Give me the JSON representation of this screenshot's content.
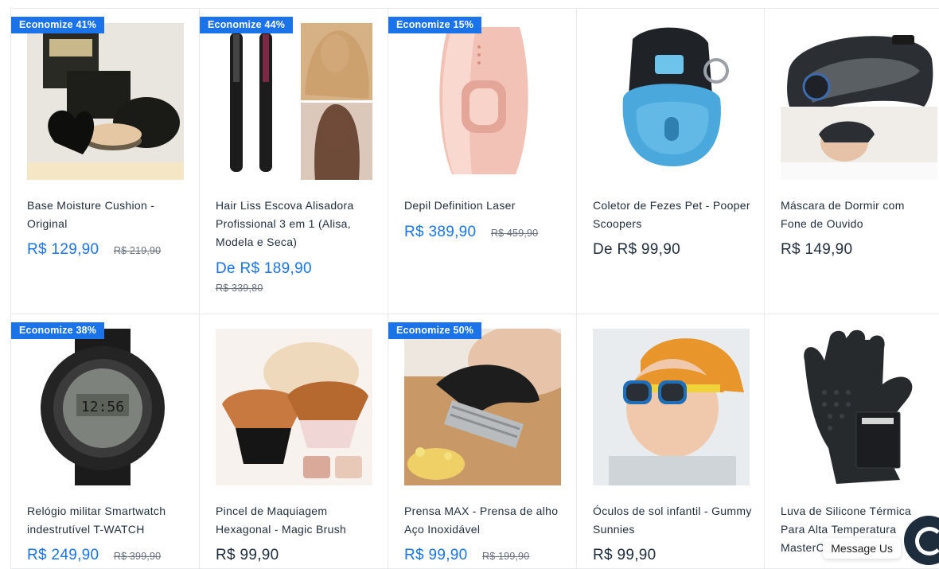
{
  "products": [
    {
      "badge": "Economize 41%",
      "title": "Base Moisture Cushion - Original",
      "price": "R$ 129,90",
      "compare": "R$ 219,90"
    },
    {
      "badge": "Economize 44%",
      "title": "Hair Liss Escova Alisadora Profissional 3 em 1 (Alisa, Modela e Seca)",
      "price": "De R$ 189,90",
      "compare": "R$ 339,80"
    },
    {
      "badge": "Economize 15%",
      "title": "Depil Definition Laser",
      "price": "R$ 389,90",
      "compare": "R$ 459,90"
    },
    {
      "badge": "",
      "title": "Coletor de Fezes Pet - Pooper Scoopers",
      "price": "De R$ 99,90",
      "compare": ""
    },
    {
      "badge": "",
      "title": "Máscara de Dormir com Fone de Ouvido",
      "price": "R$ 149,90",
      "compare": ""
    },
    {
      "badge": "Economize 38%",
      "title": "Relógio militar Smartwatch indestrutível T-WATCH",
      "price": "R$ 249,90",
      "compare": "R$ 399,90"
    },
    {
      "badge": "",
      "title": "Pincel de Maquiagem Hexagonal - Magic Brush",
      "price": "R$ 99,90",
      "compare": ""
    },
    {
      "badge": "Economize 50%",
      "title": "Prensa MAX - Prensa de alho Aço Inoxidável",
      "price": "R$ 99,90",
      "compare": "R$ 199,90"
    },
    {
      "badge": "",
      "title": "Óculos de sol infantil - Gummy Sunnies",
      "price": "R$ 99,90",
      "compare": ""
    },
    {
      "badge": "",
      "title": "Luva de Silicone Térmica Para Alta Temperatura MasterC",
      "price": "",
      "compare": ""
    }
  ],
  "chat": {
    "message": "Message Us"
  },
  "colors": {
    "accent": "#1a73e8",
    "text": "#1e2d3c",
    "muted": "#68717d"
  }
}
